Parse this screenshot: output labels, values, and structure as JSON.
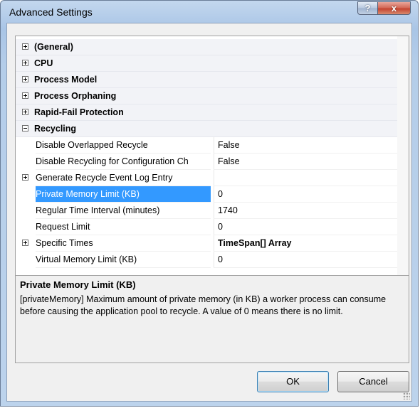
{
  "window": {
    "title": "Advanced Settings",
    "help_glyph": "?",
    "close_glyph": "x"
  },
  "grid": {
    "categories_before": [
      {
        "label": "(General)",
        "expanded": false
      },
      {
        "label": "CPU",
        "expanded": false
      },
      {
        "label": "Process Model",
        "expanded": false
      },
      {
        "label": "Process Orphaning",
        "expanded": false
      },
      {
        "label": "Rapid-Fail Protection",
        "expanded": false
      }
    ],
    "recycling": {
      "label": "Recycling",
      "expanded": true,
      "properties": [
        {
          "name": "Disable Overlapped Recycle",
          "value": "False",
          "expandable": false
        },
        {
          "name": "Disable Recycling for Configuration Ch",
          "value": "False",
          "expandable": false
        },
        {
          "name": "Generate Recycle Event Log Entry",
          "value": "",
          "expandable": true
        },
        {
          "name": "Private Memory Limit (KB)",
          "value": "0",
          "expandable": false,
          "selected": true
        },
        {
          "name": "Regular Time Interval (minutes)",
          "value": "1740",
          "expandable": false
        },
        {
          "name": "Request Limit",
          "value": "0",
          "expandable": false
        },
        {
          "name": "Specific Times",
          "value": "TimeSpan[] Array",
          "expandable": true,
          "bold_value": true
        },
        {
          "name": "Virtual Memory Limit (KB)",
          "value": "0",
          "expandable": false
        }
      ]
    }
  },
  "description": {
    "title": "Private Memory Limit (KB)",
    "text": "[privateMemory] Maximum amount of private memory (in KB) a worker process can consume before causing the application pool to recycle.  A value of 0 means there is no limit."
  },
  "buttons": {
    "ok": "OK",
    "cancel": "Cancel"
  },
  "colors": {
    "selection": "#3399ff",
    "title_bar": "#a9c5e6"
  }
}
